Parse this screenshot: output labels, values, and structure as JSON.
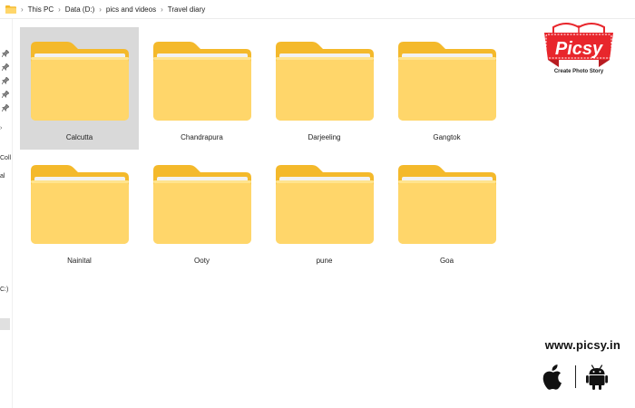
{
  "breadcrumb": {
    "items": [
      "This PC",
      "Data (D:)",
      "pics and videos",
      "Travel diary"
    ],
    "separator": "›"
  },
  "nav": {
    "partial_labels": [
      "Coll",
      "al",
      "C:)"
    ],
    "expand_arrow": "›"
  },
  "folders": [
    {
      "name": "Calcutta",
      "selected": true
    },
    {
      "name": "Chandrapura",
      "selected": false
    },
    {
      "name": "Darjeeling",
      "selected": false
    },
    {
      "name": "Gangtok",
      "selected": false
    },
    {
      "name": "Nainital",
      "selected": false
    },
    {
      "name": "Ooty",
      "selected": false
    },
    {
      "name": "pune",
      "selected": false
    },
    {
      "name": "Goa",
      "selected": false
    }
  ],
  "branding": {
    "logo_text": "Picsy",
    "tagline": "Create Photo Story",
    "website": "www.picsy.in",
    "platforms": [
      "apple-icon",
      "android-icon"
    ]
  },
  "colors": {
    "folder_back": "#F4B92B",
    "folder_front": "#FFD66A",
    "selection": "#D9D9D9",
    "logo_red": "#E8262C"
  }
}
